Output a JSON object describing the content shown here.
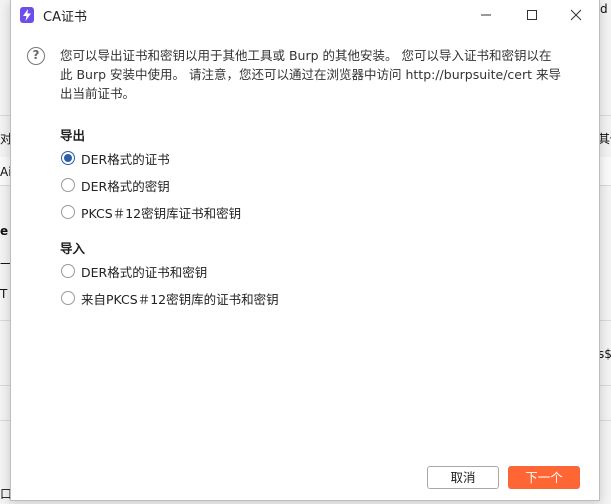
{
  "background_app": {
    "fragments": [
      "对",
      "Ai",
      "e",
      "一",
      "T",
      "d",
      "其他",
      "s$",
      "口"
    ]
  },
  "dialog": {
    "title": "CA证书",
    "window_controls": {
      "minimize": "minimize-icon",
      "maximize": "maximize-icon",
      "close": "close-icon"
    },
    "description_line1": "您可以导出证书和密钥以用于其他工具或 Burp 的其他安装。 您可以导入证书和密钥以在",
    "description_line2": "此 Burp 安装中使用。 请注意，您还可以通过在浏览器中访问 http://burpsuite/cert 来导",
    "description_line3": "出当前证书。",
    "export_section": {
      "heading": "导出",
      "options": [
        {
          "label": "DER格式的证书",
          "selected": true
        },
        {
          "label": "DER格式的密钥",
          "selected": false
        },
        {
          "label": "PKCS＃12密钥库证书和密钥",
          "selected": false
        }
      ]
    },
    "import_section": {
      "heading": "导入",
      "options": [
        {
          "label": "DER格式的证书和密钥",
          "selected": false
        },
        {
          "label": "来自PKCS＃12密钥库的证书和密钥",
          "selected": false
        }
      ]
    },
    "buttons": {
      "cancel": "取消",
      "next": "下一个"
    },
    "colors": {
      "accent": "#2b5fa8",
      "primary_button": "#ff6633",
      "app_icon": "#6d4ee8"
    }
  }
}
